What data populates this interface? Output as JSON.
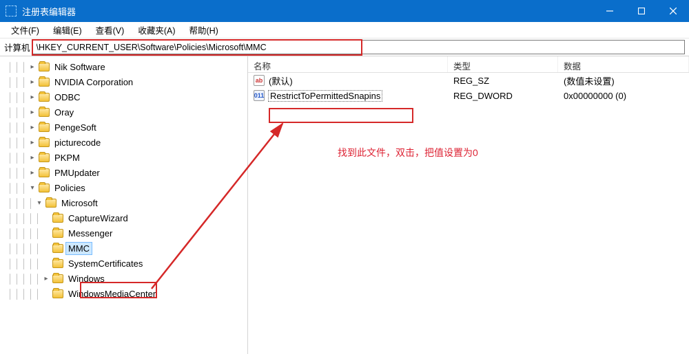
{
  "window": {
    "title": "注册表编辑器"
  },
  "menu": {
    "file": "文件(F)",
    "edit": "编辑(E)",
    "view": "查看(V)",
    "favorites": "收藏夹(A)",
    "help": "帮助(H)"
  },
  "address": {
    "label": "计算机",
    "path": "\\HKEY_CURRENT_USER\\Software\\Policies\\Microsoft\\MMC"
  },
  "tree": {
    "items": [
      {
        "indent": 3,
        "twisty": ">",
        "label": "Nik Software"
      },
      {
        "indent": 3,
        "twisty": ">",
        "label": "NVIDIA Corporation"
      },
      {
        "indent": 3,
        "twisty": ">",
        "label": "ODBC"
      },
      {
        "indent": 3,
        "twisty": ">",
        "label": "Oray"
      },
      {
        "indent": 3,
        "twisty": ">",
        "label": "PengeSoft"
      },
      {
        "indent": 3,
        "twisty": ">",
        "label": "picturecode"
      },
      {
        "indent": 3,
        "twisty": ">",
        "label": "PKPM"
      },
      {
        "indent": 3,
        "twisty": ">",
        "label": "PMUpdater"
      },
      {
        "indent": 3,
        "twisty": "v",
        "label": "Policies"
      },
      {
        "indent": 4,
        "twisty": "v",
        "label": "Microsoft"
      },
      {
        "indent": 5,
        "twisty": "",
        "label": "CaptureWizard"
      },
      {
        "indent": 5,
        "twisty": "",
        "label": "Messenger"
      },
      {
        "indent": 5,
        "twisty": "",
        "label": "MMC",
        "selected": true
      },
      {
        "indent": 5,
        "twisty": "",
        "label": "SystemCertificates"
      },
      {
        "indent": 5,
        "twisty": ">",
        "label": "Windows"
      },
      {
        "indent": 5,
        "twisty": "",
        "label": "WindowsMediaCenter"
      }
    ]
  },
  "list": {
    "columns": {
      "name": "名称",
      "type": "类型",
      "data": "数据"
    },
    "rows": [
      {
        "icon": "ab",
        "name": "(默认)",
        "type": "REG_SZ",
        "data": "(数值未设置)"
      },
      {
        "icon": "dw",
        "name": "RestrictToPermittedSnapins",
        "type": "REG_DWORD",
        "data": "0x00000000 (0)",
        "highlighted": true
      }
    ]
  },
  "annotation": {
    "text": "找到此文件，双击，把值设置为0"
  }
}
